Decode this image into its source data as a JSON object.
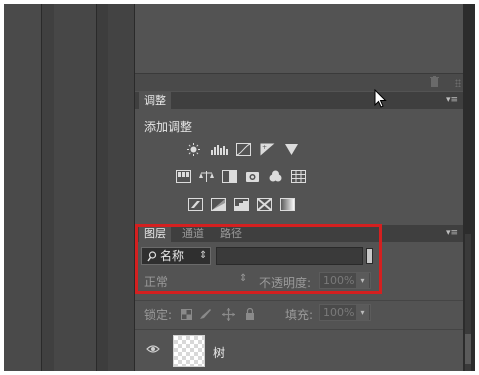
{
  "adjustments_panel": {
    "tab_label": "调整",
    "title": "添加调整",
    "menu_icon": "panel-menu-icon",
    "icons_row1": [
      "brightness-contrast-icon",
      "levels-icon",
      "curves-icon",
      "exposure-icon",
      "vibrance-icon"
    ],
    "icons_row2": [
      "hue-saturation-icon",
      "color-balance-icon",
      "black-white-icon",
      "photo-filter-icon",
      "channel-mixer-icon",
      "color-lookup-icon"
    ],
    "icons_row3": [
      "invert-icon",
      "posterize-icon",
      "threshold-icon",
      "selective-color-icon",
      "gradient-map-icon"
    ]
  },
  "top_toolbar": {
    "trash_icon": "trash-icon"
  },
  "layers_panel": {
    "tabs": [
      {
        "label": "图层",
        "active": true
      },
      {
        "label": "通道",
        "active": false
      },
      {
        "label": "路径",
        "active": false
      }
    ],
    "menu_icon": "panel-menu-icon",
    "filter": {
      "search_icon": "search-icon",
      "kind_label": "名称",
      "toggle_arrows": "⇕"
    },
    "blend_mode": "正常",
    "opacity_label": "不透明度:",
    "opacity_value": "100%",
    "lock_label": "锁定:",
    "fill_label": "填充:",
    "fill_value": "100%",
    "layers": [
      {
        "name": "树",
        "visible": true
      }
    ]
  },
  "colors": {
    "panel_bg": "#535353",
    "highlight_border": "#d42020"
  }
}
